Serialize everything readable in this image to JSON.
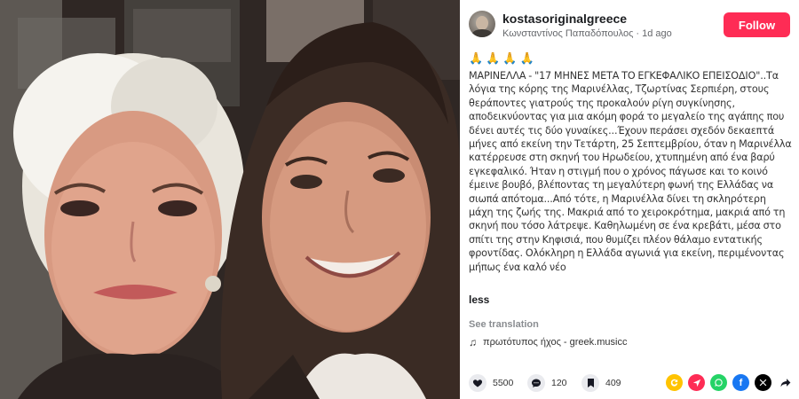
{
  "post": {
    "username": "kostasoriginalgreece",
    "author_name": "Κωνσταντίνος Παπαδόπουλος",
    "time_ago": "1d ago",
    "follow_label": "Follow",
    "emojis": [
      "🙏",
      "🙏",
      "🙏",
      "🙏"
    ],
    "caption": "ΜΑΡΙΝΕΛΛΑ - \"17 ΜΗΝΕΣ ΜΕΤΑ ΤΟ ΕΓΚΕΦΑΛΙΚΟ ΕΠΕΙΣΟΔΙΟ\"..Τα λόγια της κόρης της Μαρινέλλας, Τζωρτίνας Σερπιέρη, στους θεράποντες γιατρούς της προκαλούν ρίγη συγκίνησης, αποδεικνύοντας για μια ακόμη φορά το μεγαλείο της αγάπης που δένει αυτές τις δύο γυναίκες...Έχουν περάσει σχεδόν δεκαεπτά μήνες από εκείνη την Τετάρτη, 25 Σεπτεμβρίου, όταν η Μαρινέλλα κατέρρευσε στη σκηνή του Ηρωδείου, χτυπημένη από ένα βαρύ εγκεφαλικό. Ήταν η στιγμή που ο χρόνος πάγωσε και το κοινό έμεινε βουβό, βλέποντας τη μεγαλύτερη φωνή της Ελλάδας να σιωπά απότομα...Από τότε, η Μαρινέλλα δίνει τη σκληρότερη μάχη της ζωής της. Μακριά από το χειροκρότημα, μακριά από τη σκηνή που τόσο λάτρεψε. Καθηλωμένη σε ένα κρεβάτι, μέσα στο σπίτι της στην Κηφισιά, που θυμίζει πλέον θάλαμο εντατικής φροντίδας. Ολόκληρη η Ελλάδα αγωνιά για εκείνη, περιμένοντας μήπως ένα καλό νέο",
    "less_label": "less",
    "see_translation_label": "See translation",
    "sound_label": "πρωτότυπος ήχος - greek.musicc"
  },
  "stats": {
    "likes": "5500",
    "comments": "120",
    "saves": "409"
  },
  "share_icons": [
    "repost-icon",
    "telegram-icon",
    "whatsapp-icon",
    "facebook-icon",
    "x-icon",
    "forward-icon"
  ],
  "colors": {
    "follow_bg": "#fe2c55",
    "muted_text": "#65676b"
  }
}
